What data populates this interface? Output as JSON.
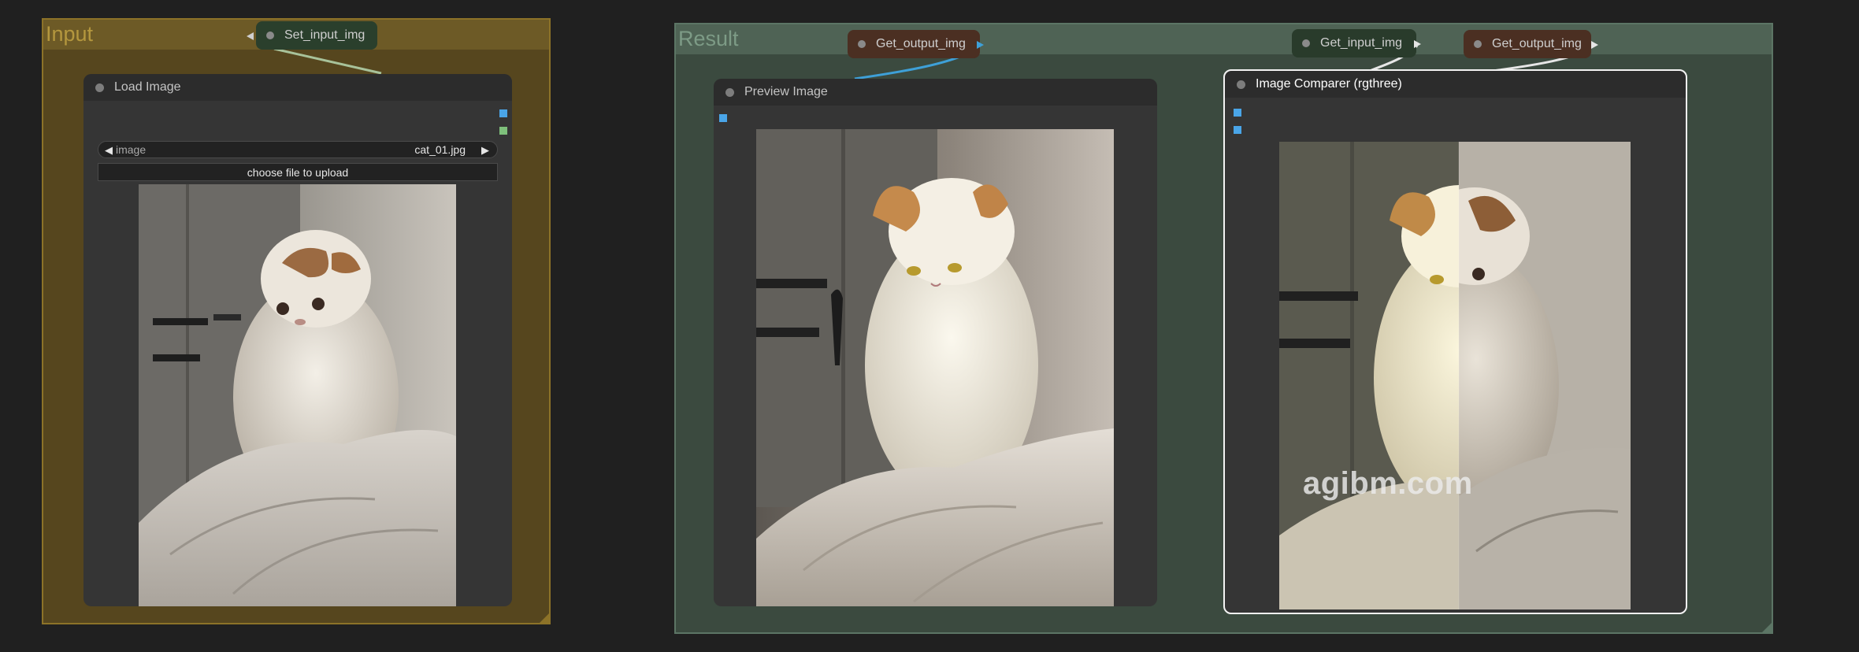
{
  "groups": {
    "input": {
      "title": "Input"
    },
    "result": {
      "title": "Result"
    }
  },
  "reroute_nodes": {
    "set_input": {
      "label": "Set_input_img"
    },
    "get_output_1": {
      "label": "Get_output_img"
    },
    "get_input": {
      "label": "Get_input_img"
    },
    "get_output_2": {
      "label": "Get_output_img"
    }
  },
  "load_image": {
    "title": "Load Image",
    "widget_name": "image",
    "widget_value": "cat_01.jpg",
    "upload_button": "choose file to upload",
    "arrow_left": "◀",
    "arrow_right": "▶"
  },
  "preview_image": {
    "title": "Preview Image"
  },
  "image_comparer": {
    "title": "Image Comparer (rgthree)",
    "split_fraction": 0.51
  },
  "watermark": {
    "text": "agibm.com"
  },
  "colors": {
    "canvas": "#202020",
    "input_group": "#56461e",
    "result_group": "#3b4a3f",
    "link_image": "#3ea0d8",
    "port_image": "#4aa5e8",
    "port_mask": "#7ec07b"
  }
}
